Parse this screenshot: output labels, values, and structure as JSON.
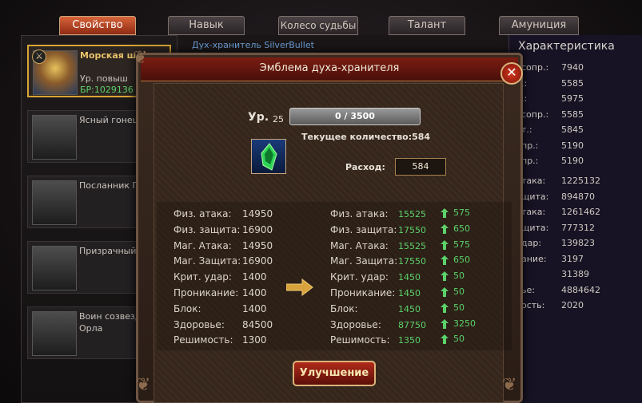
{
  "tabs": [
    {
      "label": "Свойство",
      "active": true
    },
    {
      "label": "Навык",
      "active": false
    },
    {
      "label": "Колесо судьбы",
      "active": false
    },
    {
      "label": "Талант",
      "active": false
    },
    {
      "label": "Амуниция",
      "active": false
    }
  ],
  "header_link": "Дух-хранитель SilverBullet",
  "cards": [
    {
      "name": "Морская шаманка",
      "level_text": "Ур. повыш",
      "power_text": "БР:1029136"
    },
    {
      "name": "Ясный гонец",
      "level_text": "",
      "power_text": ""
    },
    {
      "name": "Посланник П",
      "level_text": "",
      "power_text": ""
    },
    {
      "name": "Призрачный страж",
      "level_text": "",
      "power_text": ""
    },
    {
      "name": "Воин созвездия Орла",
      "level_text": "",
      "power_text": ""
    }
  ],
  "right_panel": {
    "title": "Характеристика",
    "rows_top": [
      {
        "label": "сопр.:",
        "value": "7940"
      },
      {
        "label": ".:",
        "value": "5585"
      },
      {
        "label": ".:",
        "value": "5975"
      },
      {
        "label": "сопр.:",
        "value": "5585"
      },
      {
        "label": "т.:",
        "value": "5845"
      },
      {
        "label": "пр.:",
        "value": "5190"
      },
      {
        "label": "пр.:",
        "value": "5190"
      }
    ],
    "rows_bottom": [
      {
        "label": "така:",
        "value": "1225132"
      },
      {
        "label": "щита:",
        "value": "894870"
      },
      {
        "label": "така:",
        "value": "1261462"
      },
      {
        "label": "щита:",
        "value": "777312"
      },
      {
        "label": "дар:",
        "value": "139823"
      },
      {
        "label": "ание:",
        "value": "3197"
      },
      {
        "label": "",
        "value": "31389"
      },
      {
        "label": "ье:",
        "value": "4884642"
      },
      {
        "label": "ость:",
        "value": "2020"
      }
    ]
  },
  "modal": {
    "title": "Эмблема духа-хранителя",
    "close_label": "✕",
    "level_label": "Ур.",
    "level_value": "25",
    "xp_text": "0 / 3500",
    "xp_progress": 0,
    "current_count": "Текущее количество:584",
    "spend_label": "Расход:",
    "spend_value": "584",
    "upgrade_label": "Улучшение",
    "stats": [
      {
        "label": "Физ. атака:",
        "current": "14950",
        "new_label": "Физ. атака:",
        "new": "15525",
        "inc": "575"
      },
      {
        "label": "Физ. защита:",
        "current": "16900",
        "new_label": "Физ. защита:",
        "new": "17550",
        "inc": "650"
      },
      {
        "label": "Маг. Атака:",
        "current": "14950",
        "new_label": "Маг. Атака:",
        "new": "15525",
        "inc": "575"
      },
      {
        "label": "Маг. Защита:",
        "current": "16900",
        "new_label": "Маг. Защита:",
        "new": "17550",
        "inc": "650"
      },
      {
        "label": "Крит. удар:",
        "current": "1400",
        "new_label": "Крит. удар:",
        "new": "1450",
        "inc": "50"
      },
      {
        "label": "Проникание:",
        "current": "1400",
        "new_label": "Проникание:",
        "new": "1450",
        "inc": "50"
      },
      {
        "label": "Блок:",
        "current": "1400",
        "new_label": "Блок:",
        "new": "1450",
        "inc": "50"
      },
      {
        "label": "Здоровье:",
        "current": "84500",
        "new_label": "Здоровье:",
        "new": "87750",
        "inc": "3250"
      },
      {
        "label": "Решимость:",
        "current": "1300",
        "new_label": "Решимость:",
        "new": "1350",
        "inc": "50"
      }
    ]
  },
  "colors": {
    "accent": "#d7643a",
    "increase": "#5cd16a",
    "title_bar": "#7a1d12"
  }
}
